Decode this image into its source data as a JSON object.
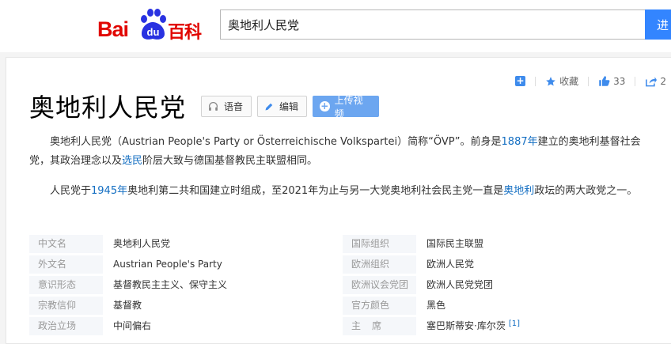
{
  "header": {
    "logo_text_1": "Bai",
    "logo_text_2": "du",
    "logo_text_3": "百科",
    "search_value": "奥地利人民党",
    "search_button": "进",
    "brand_color": "#e10601",
    "accent_color": "#3385ff"
  },
  "toolbar": {
    "add_icon": "plus-square-icon",
    "collect_label": "收藏",
    "like_count": "33",
    "share_count": "2"
  },
  "article": {
    "title": "奥地利人民党",
    "voice_button": "语音",
    "edit_button": "编辑",
    "upload_button": "上传视频",
    "para1": {
      "t1": "奥地利人民党（Austrian People's Party or Österreichische Volkspartei）简称“ÖVP”。前身是",
      "l1": "1887年",
      "t2": "建立的奥地利基督社会党，其政治理念以及",
      "l2": "选民",
      "t3": "阶层大致与德国基督教民主联盟相同。"
    },
    "para2": {
      "t1": "人民党于",
      "l1": "1945年",
      "t2": "奥地利第二共和国建立时组成，至2021年为止与另一大党奥地利社会民主党一直是",
      "l2": "奥地利",
      "t3": "政坛的两大政党之一。"
    }
  },
  "infobox": {
    "rows": [
      {
        "k1": "中文名",
        "v1": "奥地利人民党",
        "k2": "国际组织",
        "v2": "国际民主联盟"
      },
      {
        "k1": "外文名",
        "v1": "Austrian People's Party",
        "k2": "欧洲组织",
        "v2": "欧洲人民党"
      },
      {
        "k1": "意识形态",
        "v1": "基督教民主主义、保守主义",
        "k2": "欧洲议会党团",
        "v2": "欧洲人民党党团"
      },
      {
        "k1": "宗教信仰",
        "v1": "基督教",
        "k2": "官方颜色",
        "v2": "黑色"
      },
      {
        "k1": "政治立场",
        "v1": "中间偏右",
        "k2": "主席",
        "v2": "塞巴斯蒂安·库尔茨",
        "ref": "[1]"
      }
    ]
  }
}
